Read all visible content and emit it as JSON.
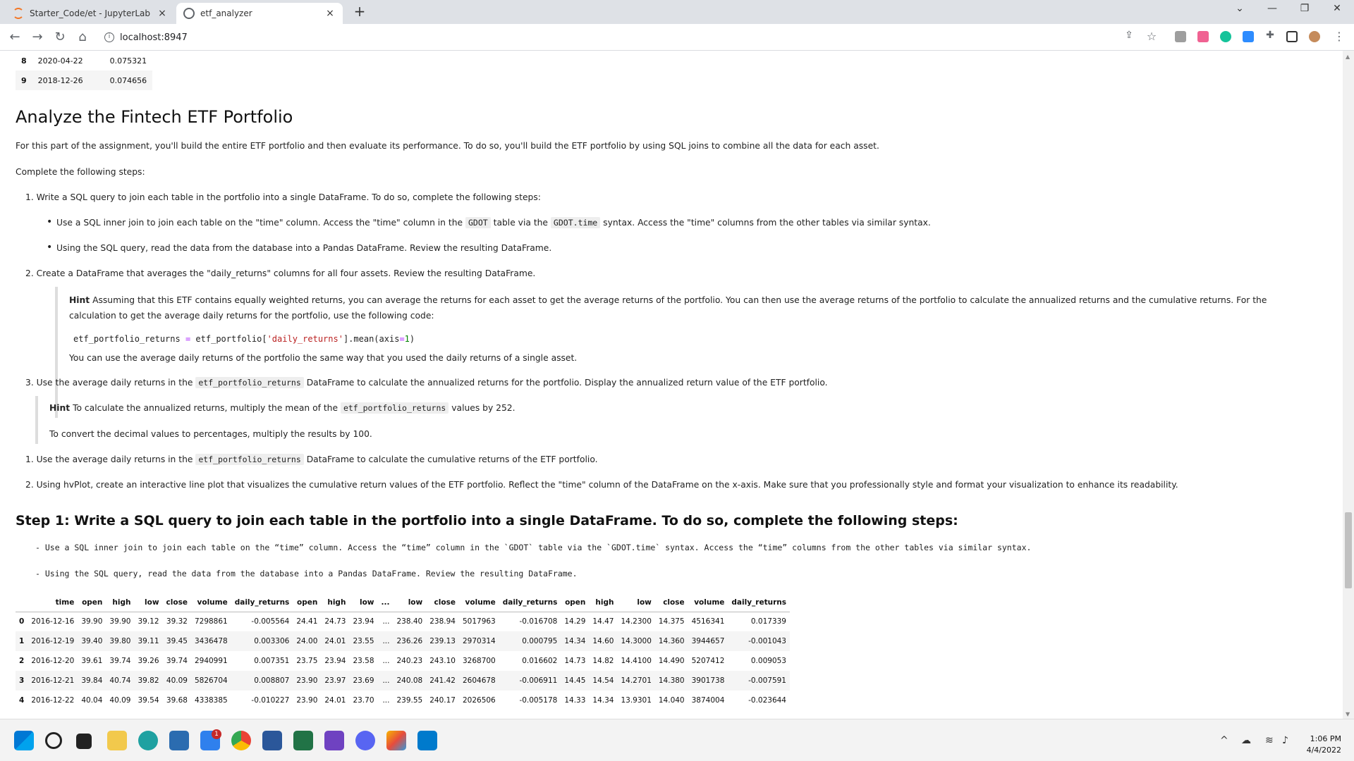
{
  "browser": {
    "tabs": [
      {
        "title": "Starter_Code/et - JupyterLab",
        "icon": "jupyter-icon"
      },
      {
        "title": "etf_analyzer",
        "icon": "globe-icon"
      }
    ],
    "new_tab": "+",
    "close_glyph": "×",
    "url": "localhost:8947"
  },
  "small_table": [
    {
      "idx": "8",
      "date": "2020-04-22",
      "value": "0.075321"
    },
    {
      "idx": "9",
      "date": "2018-12-26",
      "value": "0.074656"
    }
  ],
  "section": {
    "title": "Analyze the Fintech ETF Portfolio",
    "intro": "For this part of the assignment, you'll build the entire ETF portfolio and then evaluate its performance. To do so, you'll build the ETF portfolio by using SQL joins to combine all the data for each asset.",
    "complete_steps": "Complete the following steps:",
    "step1": "1. Write a SQL query to join each table in the portfolio into a single DataFrame. To do so, complete the following steps:",
    "bullet1_a": "Use a SQL inner join to join each table on the \"time\" column. Access the \"time\" column in the",
    "bullet1_code1": "GDOT",
    "bullet1_b": "table via the",
    "bullet1_code2": "GDOT.time",
    "bullet1_c": "syntax. Access the \"time\" columns from the other tables via similar syntax.",
    "bullet2": "Using the SQL query, read the data from the database into a Pandas DataFrame. Review the resulting DataFrame.",
    "step2": "2. Create a DataFrame that averages the \"daily_returns\" columns for all four assets. Review the resulting DataFrame.",
    "hint1_bold": "Hint",
    "hint1_line1": "Assuming that this ETF contains equally weighted returns, you can average the returns for each asset to get the average returns of the portfolio. You can then use the average returns of the portfolio to calculate the annualized returns and the cumulative returns. For the",
    "hint1_line2": "calculation to get the average daily returns for the portfolio, use the following code:",
    "code_a": "etf_portfolio_returns",
    "code_eq": "=",
    "code_b": "etf_portfolio[",
    "code_str": "'daily_returns'",
    "code_c": "].mean(axis",
    "code_eq2": "=",
    "code_num": "1",
    "code_d": ")",
    "hint1_after": "You can use the average daily returns of the portfolio the same way that you used the daily returns of a single asset.",
    "step3_a": "3. Use the average daily returns in the",
    "step3_code": "etf_portfolio_returns",
    "step3_b": "DataFrame to calculate the annualized returns for the portfolio. Display the annualized return value of the ETF portfolio.",
    "hint2_bold": "Hint",
    "hint2_a": "To calculate the annualized returns, multiply the mean of the",
    "hint2_code": "etf_portfolio_returns",
    "hint2_b": "values by 252.",
    "hint2_line2": "To convert the decimal values to percentages, multiply the results by 100.",
    "step4_a": "1. Use the average daily returns in the",
    "step4_code": "etf_portfolio_returns",
    "step4_b": "DataFrame to calculate the cumulative returns of the ETF portfolio.",
    "step5": "2. Using hvPlot, create an interactive line plot that visualizes the cumulative return values of the ETF portfolio. Reflect the \"time\" column of the DataFrame on the x-axis. Make sure that you professionally style and format your visualization to enhance its readability."
  },
  "step_section": {
    "title": "Step 1: Write a SQL query to join each table in the portfolio into a single DataFrame. To do so, complete the following steps:",
    "line1": "- Use a SQL inner join to join each table on the “time” column. Access the “time” column in the `GDOT` table via the `GDOT.time` syntax. Access the “time” columns from the other tables via similar syntax.",
    "line2": "- Using the SQL query, read the data from the database into a Pandas DataFrame. Review the resulting DataFrame."
  },
  "big_table": {
    "headers": [
      "",
      "time",
      "open",
      "high",
      "low",
      "close",
      "volume",
      "daily_returns",
      "open",
      "high",
      "low",
      "...",
      "low",
      "close",
      "volume",
      "daily_returns",
      "open",
      "high",
      "low",
      "close",
      "volume",
      "daily_returns"
    ],
    "rows": [
      [
        "0",
        "2016-12-16",
        "39.90",
        "39.90",
        "39.12",
        "39.32",
        "7298861",
        "-0.005564",
        "24.41",
        "24.73",
        "23.94",
        "...",
        "238.40",
        "238.94",
        "5017963",
        "-0.016708",
        "14.29",
        "14.47",
        "14.2300",
        "14.375",
        "4516341",
        "0.017339"
      ],
      [
        "1",
        "2016-12-19",
        "39.40",
        "39.80",
        "39.11",
        "39.45",
        "3436478",
        "0.003306",
        "24.00",
        "24.01",
        "23.55",
        "...",
        "236.26",
        "239.13",
        "2970314",
        "0.000795",
        "14.34",
        "14.60",
        "14.3000",
        "14.360",
        "3944657",
        "-0.001043"
      ],
      [
        "2",
        "2016-12-20",
        "39.61",
        "39.74",
        "39.26",
        "39.74",
        "2940991",
        "0.007351",
        "23.75",
        "23.94",
        "23.58",
        "...",
        "240.23",
        "243.10",
        "3268700",
        "0.016602",
        "14.73",
        "14.82",
        "14.4100",
        "14.490",
        "5207412",
        "0.009053"
      ],
      [
        "3",
        "2016-12-21",
        "39.84",
        "40.74",
        "39.82",
        "40.09",
        "5826704",
        "0.008807",
        "23.90",
        "23.97",
        "23.69",
        "...",
        "240.08",
        "241.42",
        "2604678",
        "-0.006911",
        "14.45",
        "14.54",
        "14.2701",
        "14.380",
        "3901738",
        "-0.007591"
      ],
      [
        "4",
        "2016-12-22",
        "40.04",
        "40.09",
        "39.54",
        "39.68",
        "4338385",
        "-0.010227",
        "23.90",
        "24.01",
        "23.70",
        "...",
        "239.55",
        "240.17",
        "2026506",
        "-0.005178",
        "14.33",
        "14.34",
        "13.9301",
        "14.040",
        "3874004",
        "-0.023644"
      ]
    ]
  },
  "taskbar": {
    "time": "1:06 PM",
    "date": "4/4/2022",
    "badge": "1"
  }
}
